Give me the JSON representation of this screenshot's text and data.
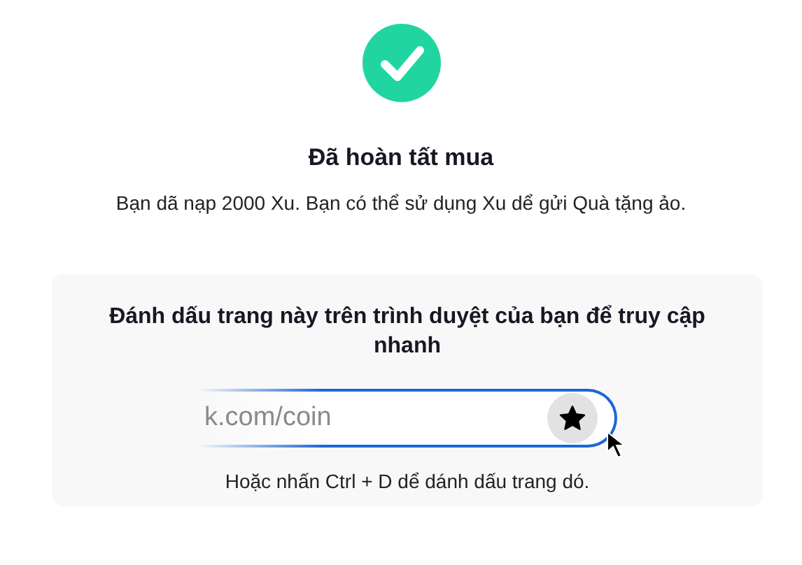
{
  "status": {
    "title": "Đã hoàn tất mua",
    "message": "Bạn dã nạp 2000 Xu. Bạn có thể sử dụng Xu dể gửi Quà tặng ảo."
  },
  "bookmark": {
    "heading": "Đánh dấu trang này trên trình duyệt của bạn để truy cập nhanh",
    "url": "k.com/coin",
    "hint": "Hoặc nhấn Ctrl + D dể dánh dấu trang dó."
  }
}
